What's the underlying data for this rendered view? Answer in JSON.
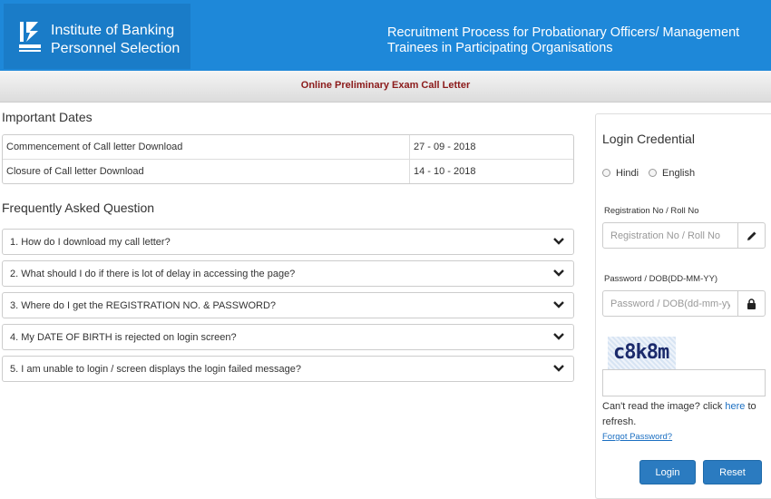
{
  "header": {
    "org_line1": "Institute of Banking",
    "org_line2": "Personnel Selection",
    "title_line1": "Recruitment Process for Probationary Officers/ Management",
    "title_line2": "Trainees in Participating Organisations"
  },
  "subheader": {
    "title": "Online Preliminary Exam Call Letter"
  },
  "important_dates": {
    "title": "Important Dates",
    "rows": [
      {
        "label": "Commencement of Call letter Download",
        "value": "27 - 09 - 2018"
      },
      {
        "label": "Closure of Call letter Download",
        "value": "14 - 10 - 2018"
      }
    ]
  },
  "faq": {
    "title": "Frequently Asked Question",
    "items": [
      "1. How do I download my call letter?",
      "2. What should I do if there is lot of delay in accessing the page?",
      "3. Where do I get the REGISTRATION NO. & PASSWORD?",
      "4. My DATE OF BIRTH is rejected on login screen?",
      "5. I am unable to login / screen displays the login failed message?"
    ]
  },
  "login": {
    "title": "Login Credential",
    "languages": [
      "Hindi",
      "English"
    ],
    "reg_label": "Registration No / Roll No",
    "reg_placeholder": "Registration No / Roll No",
    "pwd_label": "Password / DOB(DD-MM-YY)",
    "pwd_placeholder": "Password / DOB(dd-mm-yy)",
    "captcha_text": "c8k8m",
    "cant_read_prefix": "Can't read the image? click ",
    "cant_read_link": "here",
    "cant_read_suffix": " to refresh.",
    "forgot": "Forgot Password?",
    "login_button": "Login",
    "reset_button": "Reset"
  },
  "colors": {
    "header_blue": "#1e88d9",
    "subheader_text": "#8b1a1a",
    "button_blue": "#2b7bc0",
    "link_blue": "#1b6fc2"
  }
}
